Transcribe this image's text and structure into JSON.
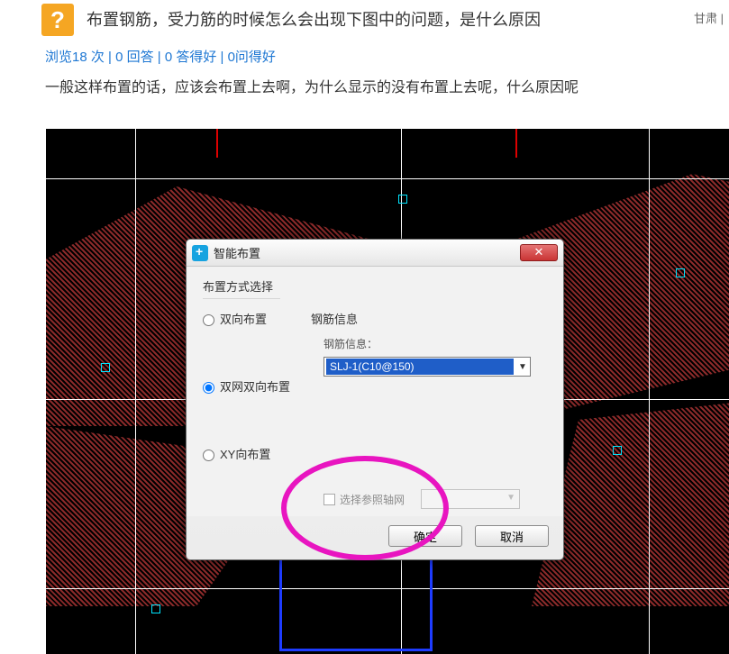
{
  "header": {
    "title": "布置钢筋，受力筋的时候怎么会出现下图中的问题，是什么原因",
    "location": "甘肃 |"
  },
  "stats": {
    "views_label": "浏览18 次",
    "answers_label": "0 回答",
    "good_answers_label": "0 答得好",
    "good_question_label": "0问得好",
    "sep": " | "
  },
  "description": "一般这样布置的话，应该会布置上去啊，为什么显示的没有布置上去呢，什么原因呢",
  "dialog": {
    "title": "智能布置",
    "group_label": "布置方式选择",
    "radios": {
      "r1": "双向布置",
      "r2": "双网双向布置",
      "r3": "XY向布置"
    },
    "selected_radio": "r2",
    "info_title": "钢筋信息",
    "info_label": "钢筋信息：",
    "select_value": "SLJ-1(C10@150)",
    "axis_checkbox_label": "选择参照轴网",
    "buttons": {
      "ok": "确定",
      "cancel": "取消"
    },
    "close": "✕"
  },
  "icons": {
    "question": "?"
  }
}
